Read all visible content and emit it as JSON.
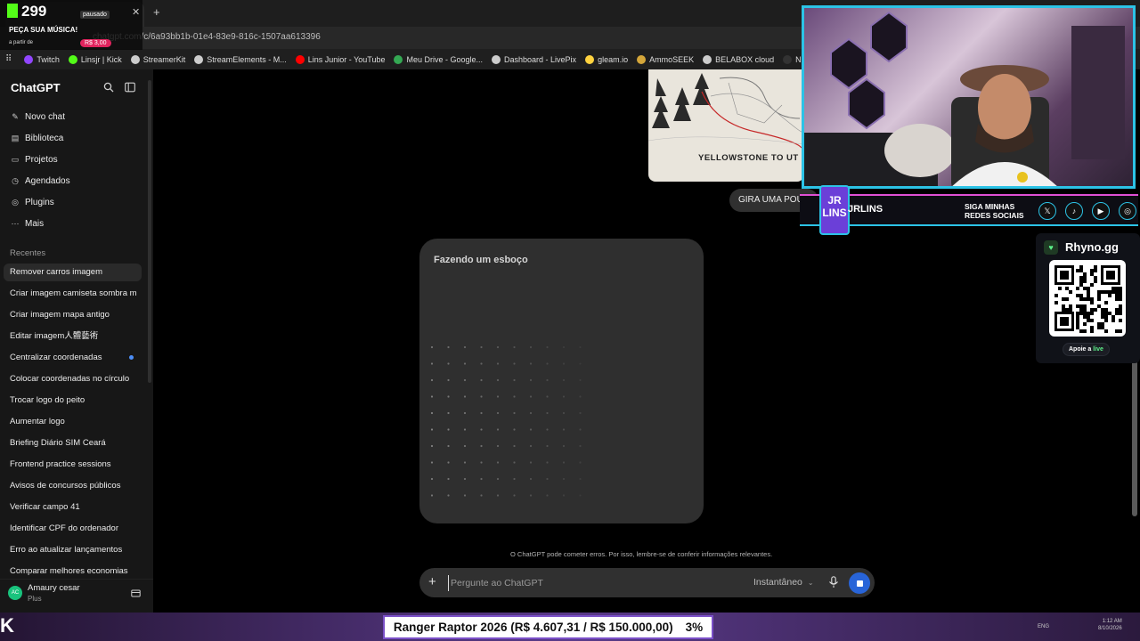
{
  "browser": {
    "url": "chatgpt.com/c/6a93bb1b-01e4-83e9-816c-1507aa613396",
    "bookmarks": [
      {
        "label": "Twitch",
        "color": "#9146ff"
      },
      {
        "label": "Linsjr | Kick",
        "color": "#53fc18"
      },
      {
        "label": "StreamerKit",
        "color": "#cccccc"
      },
      {
        "label": "StreamElements - M...",
        "color": "#cccccc"
      },
      {
        "label": "Lins Junior - YouTube",
        "color": "#ff0000"
      },
      {
        "label": "Meu Drive - Google...",
        "color": "#34a853"
      },
      {
        "label": "Dashboard - LivePix",
        "color": "#cccccc"
      },
      {
        "label": "gleam.io",
        "color": "#ffd23f"
      },
      {
        "label": "AmmoSEEK",
        "color": "#d4a63a"
      },
      {
        "label": "BELABOX cloud",
        "color": "#cccccc"
      },
      {
        "label": "Nightbot - Comm",
        "color": "#333333"
      }
    ]
  },
  "alert": {
    "count": "299",
    "status": "pausado",
    "song_prompt": "PEÇA SUA MÚSICA!",
    "from": "a partir de",
    "price": "R$ 3,00"
  },
  "sidebar": {
    "brand": "ChatGPT",
    "nav": [
      {
        "label": "Novo chat",
        "icon": "edit-icon"
      },
      {
        "label": "Biblioteca",
        "icon": "library-icon"
      },
      {
        "label": "Projetos",
        "icon": "folder-icon"
      },
      {
        "label": "Agendados",
        "icon": "clock-icon"
      },
      {
        "label": "Plugins",
        "icon": "plugins-icon"
      },
      {
        "label": "Mais",
        "icon": "more-icon"
      }
    ],
    "recent_label": "Recentes",
    "chats": [
      "Remover carros imagem",
      "Criar imagem camiseta sombra m",
      "Criar imagem mapa antigo",
      "Editar imagem人體藝術",
      "Centralizar coordenadas",
      "Colocar coordenadas no círculo",
      "Trocar logo do peito",
      "Aumentar logo",
      "Briefing Diário SIM Ceará",
      "Frontend practice sessions",
      "Avisos de concursos públicos",
      "Verificar campo 41",
      "Identificar CPF do ordenador",
      "Erro ao atualizar lançamentos",
      "Comparar melhores economias"
    ],
    "user": {
      "name": "Amaury cesar",
      "plan": "Plus",
      "initials": "AC"
    }
  },
  "main": {
    "image_caption": "YELLOWSTONE TO UT",
    "user_message": "GIRA UMA POU",
    "sketch_label": "Fazendo um esboço",
    "disclaimer": "O ChatGPT pode cometer erros. Por isso, lembre-se de conferir informações relevantes.",
    "composer_placeholder": "Pergunte ao ChatGPT",
    "model": "Instantâneo"
  },
  "stream": {
    "handle": "JRLINS",
    "social": [
      "SIGA MINHAS",
      "REDES SOCIAIS"
    ],
    "logo": "JR LINS",
    "qr_title": "Rhyno.gg",
    "qr_cta": "Apoie a",
    "qr_cta_live": "live",
    "ticker_text": "Ranger Raptor 2026 (R$ 4.607,31 / R$ 150.000,00)",
    "ticker_pct": "3%",
    "tray_lang": "ENG",
    "tray_time": "1:12 AM",
    "tray_date": "8/10/2026"
  }
}
